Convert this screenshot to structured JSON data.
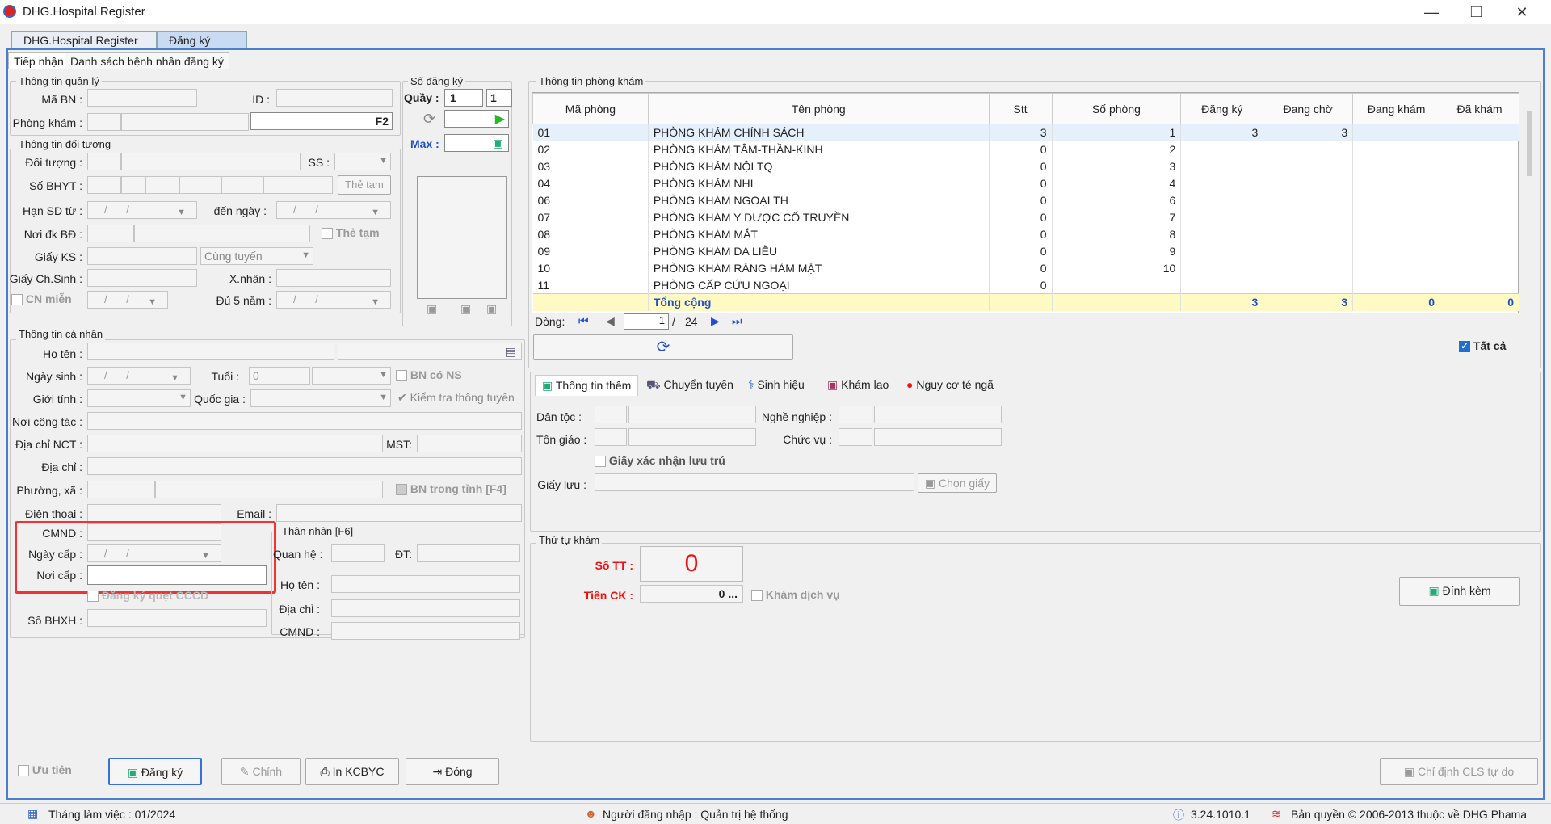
{
  "window": {
    "title": "DHG.Hospital Register"
  },
  "app_tabs": [
    "DHG.Hospital Register",
    "Đăng ký KCB"
  ],
  "sub_tabs": [
    "Tiếp nhận",
    "Danh sách bệnh nhân đăng ký"
  ],
  "quanly": {
    "title": "Thông tin quản lý",
    "ma_bn": "Mã BN :",
    "id": "ID :",
    "phong_kham": "Phòng khám :",
    "f2": "F2"
  },
  "so_dang_ky": {
    "title": "Số đăng ký",
    "quay": "Quầy :",
    "quay_v1": "1",
    "quay_v2": "1",
    "max": "Max :"
  },
  "doituong": {
    "title": "Thông tin đối tượng",
    "doi_tuong": "Đối tượng :",
    "ss": "SS :",
    "so_bhyt": "Số BHYT :",
    "the_tam": "Thẻ tạm",
    "han_sd": "Hạn SD từ :",
    "den_ngay": "đến  ngày :",
    "noi_dk": "Nơi đk BĐ :",
    "the_tam2": "Thẻ tạm",
    "giay_ks": "Giấy KS :",
    "cung_tuyen": "Cùng tuyến",
    "giay_chsinh": "Giấy Ch.Sinh :",
    "xnhan": "X.nhận :",
    "cn_mien": "CN miễn",
    "du5nam": "Đủ 5 năm :",
    "date_ph": "/   /"
  },
  "canhan": {
    "title": "Thông tin cá nhân",
    "ho_ten": "Họ tên :",
    "ngay_sinh": "Ngày sinh :",
    "tuoi": "Tuổi :",
    "tuoi_v": "0",
    "bn_co_ns": "BN có NS",
    "gioi_tinh": "Giới tính :",
    "quoc_gia": "Quốc gia :",
    "kiem_tra": "Kiểm tra thông tuyến",
    "noi_cong_tac": "Nơi công tác :",
    "dia_chi_nct": "Địa chỉ  NCT :",
    "mst": "MST:",
    "dia_chi": "Địa chỉ :",
    "phuong_xa": "Phường, xã :",
    "bn_trong_tinh": "BN trong tỉnh [F4]",
    "dien_thoai": "Điện thoại :",
    "email": "Email :",
    "cmnd": "CMND :",
    "ngay_cap": "Ngày cấp :",
    "noi_cap": "Nơi cấp :",
    "dk_quet": "Đăng ký quẹt CCCD",
    "so_bhxh": "Số BHXH :"
  },
  "thannhan": {
    "title": "Thân nhân [F6]",
    "quan_he": "Quan hệ :",
    "dt": "ĐT:",
    "ho_ten": "Họ tên :",
    "dia_chi": "Địa chỉ :",
    "cmnd": "CMND :"
  },
  "phongkham": {
    "title": "Thông tin phòng khám",
    "columns": [
      "Mã phòng",
      "Tên phòng",
      "Stt",
      "Số phòng",
      "Đăng ký",
      "Đang chờ",
      "Đang khám",
      "Đã khám"
    ],
    "rows": [
      [
        "01",
        "PHÒNG KHÁM CHÍNH SÁCH",
        "3",
        "1",
        "3",
        "3",
        "",
        ""
      ],
      [
        "02",
        "PHÒNG KHÁM TÂM-THẦN-KINH",
        "0",
        "2",
        "",
        "",
        "",
        ""
      ],
      [
        "03",
        "PHÒNG KHÁM NỘI TQ",
        "0",
        "3",
        "",
        "",
        "",
        ""
      ],
      [
        "04",
        "PHÒNG KHÁM NHI",
        "0",
        "4",
        "",
        "",
        "",
        ""
      ],
      [
        "06",
        "PHÒNG KHÁM NGOẠI TH",
        "0",
        "6",
        "",
        "",
        "",
        ""
      ],
      [
        "07",
        "PHÒNG KHÁM Y DƯỢC CỔ TRUYỀN",
        "0",
        "7",
        "",
        "",
        "",
        ""
      ],
      [
        "08",
        "PHÒNG KHÁM MẮT",
        "0",
        "8",
        "",
        "",
        "",
        ""
      ],
      [
        "09",
        "PHÒNG KHÁM DA LIỄU",
        "0",
        "9",
        "",
        "",
        "",
        ""
      ],
      [
        "10",
        "PHÒNG KHÁM RĂNG HÀM MẶT",
        "0",
        "10",
        "",
        "",
        "",
        ""
      ],
      [
        "11",
        "PHÒNG CẤP CỨU NGOẠI",
        "0",
        "",
        "",
        "",
        "",
        ""
      ]
    ],
    "total": [
      "",
      "Tổng cộng",
      "",
      "",
      "3",
      "3",
      "0",
      "0"
    ],
    "dong": "Dòng:",
    "page": "1",
    "of": "/",
    "pages": "24",
    "tat_ca": "Tất cả"
  },
  "tabs2": [
    "Thông tin thêm",
    "Chuyển tuyến",
    "Sinh hiệu",
    "Khám lao",
    "Nguy cơ té ngã"
  ],
  "them": {
    "dan_toc": "Dân tộc :",
    "nghe_nghiep": "Nghề nghiệp :",
    "ton_giao": "Tôn giáo :",
    "chuc_vu": "Chức vụ :",
    "giay_xn": "Giấy xác nhận lưu trú",
    "giay_luu": "Giấy lưu :",
    "chon_giay": "Chọn giấy"
  },
  "thutu": {
    "title": "Thứ tự khám",
    "so_tt": "Số TT :",
    "so_tt_v": "0",
    "tien_ck": "Tiền CK :",
    "tien_ck_v": "0",
    "kham_dv": "Khám dịch vụ",
    "dinh_kem": "Đính kèm"
  },
  "bottom": {
    "uu_tien": "Ưu tiên",
    "dang_ky": "Đăng ký",
    "chinh": "Chỉnh",
    "in": "In KCBYC",
    "dong": "Đóng",
    "chi_dinh": "Chỉ định CLS tự do"
  },
  "status": {
    "thang": "Tháng làm việc : 01/2024",
    "nguoi": "Người đăng nhập : Quản trị hệ thống",
    "version": "3.24.1010.1",
    "copyright": "Bản quyền © 2006-2013 thuộc về DHG Phama"
  }
}
